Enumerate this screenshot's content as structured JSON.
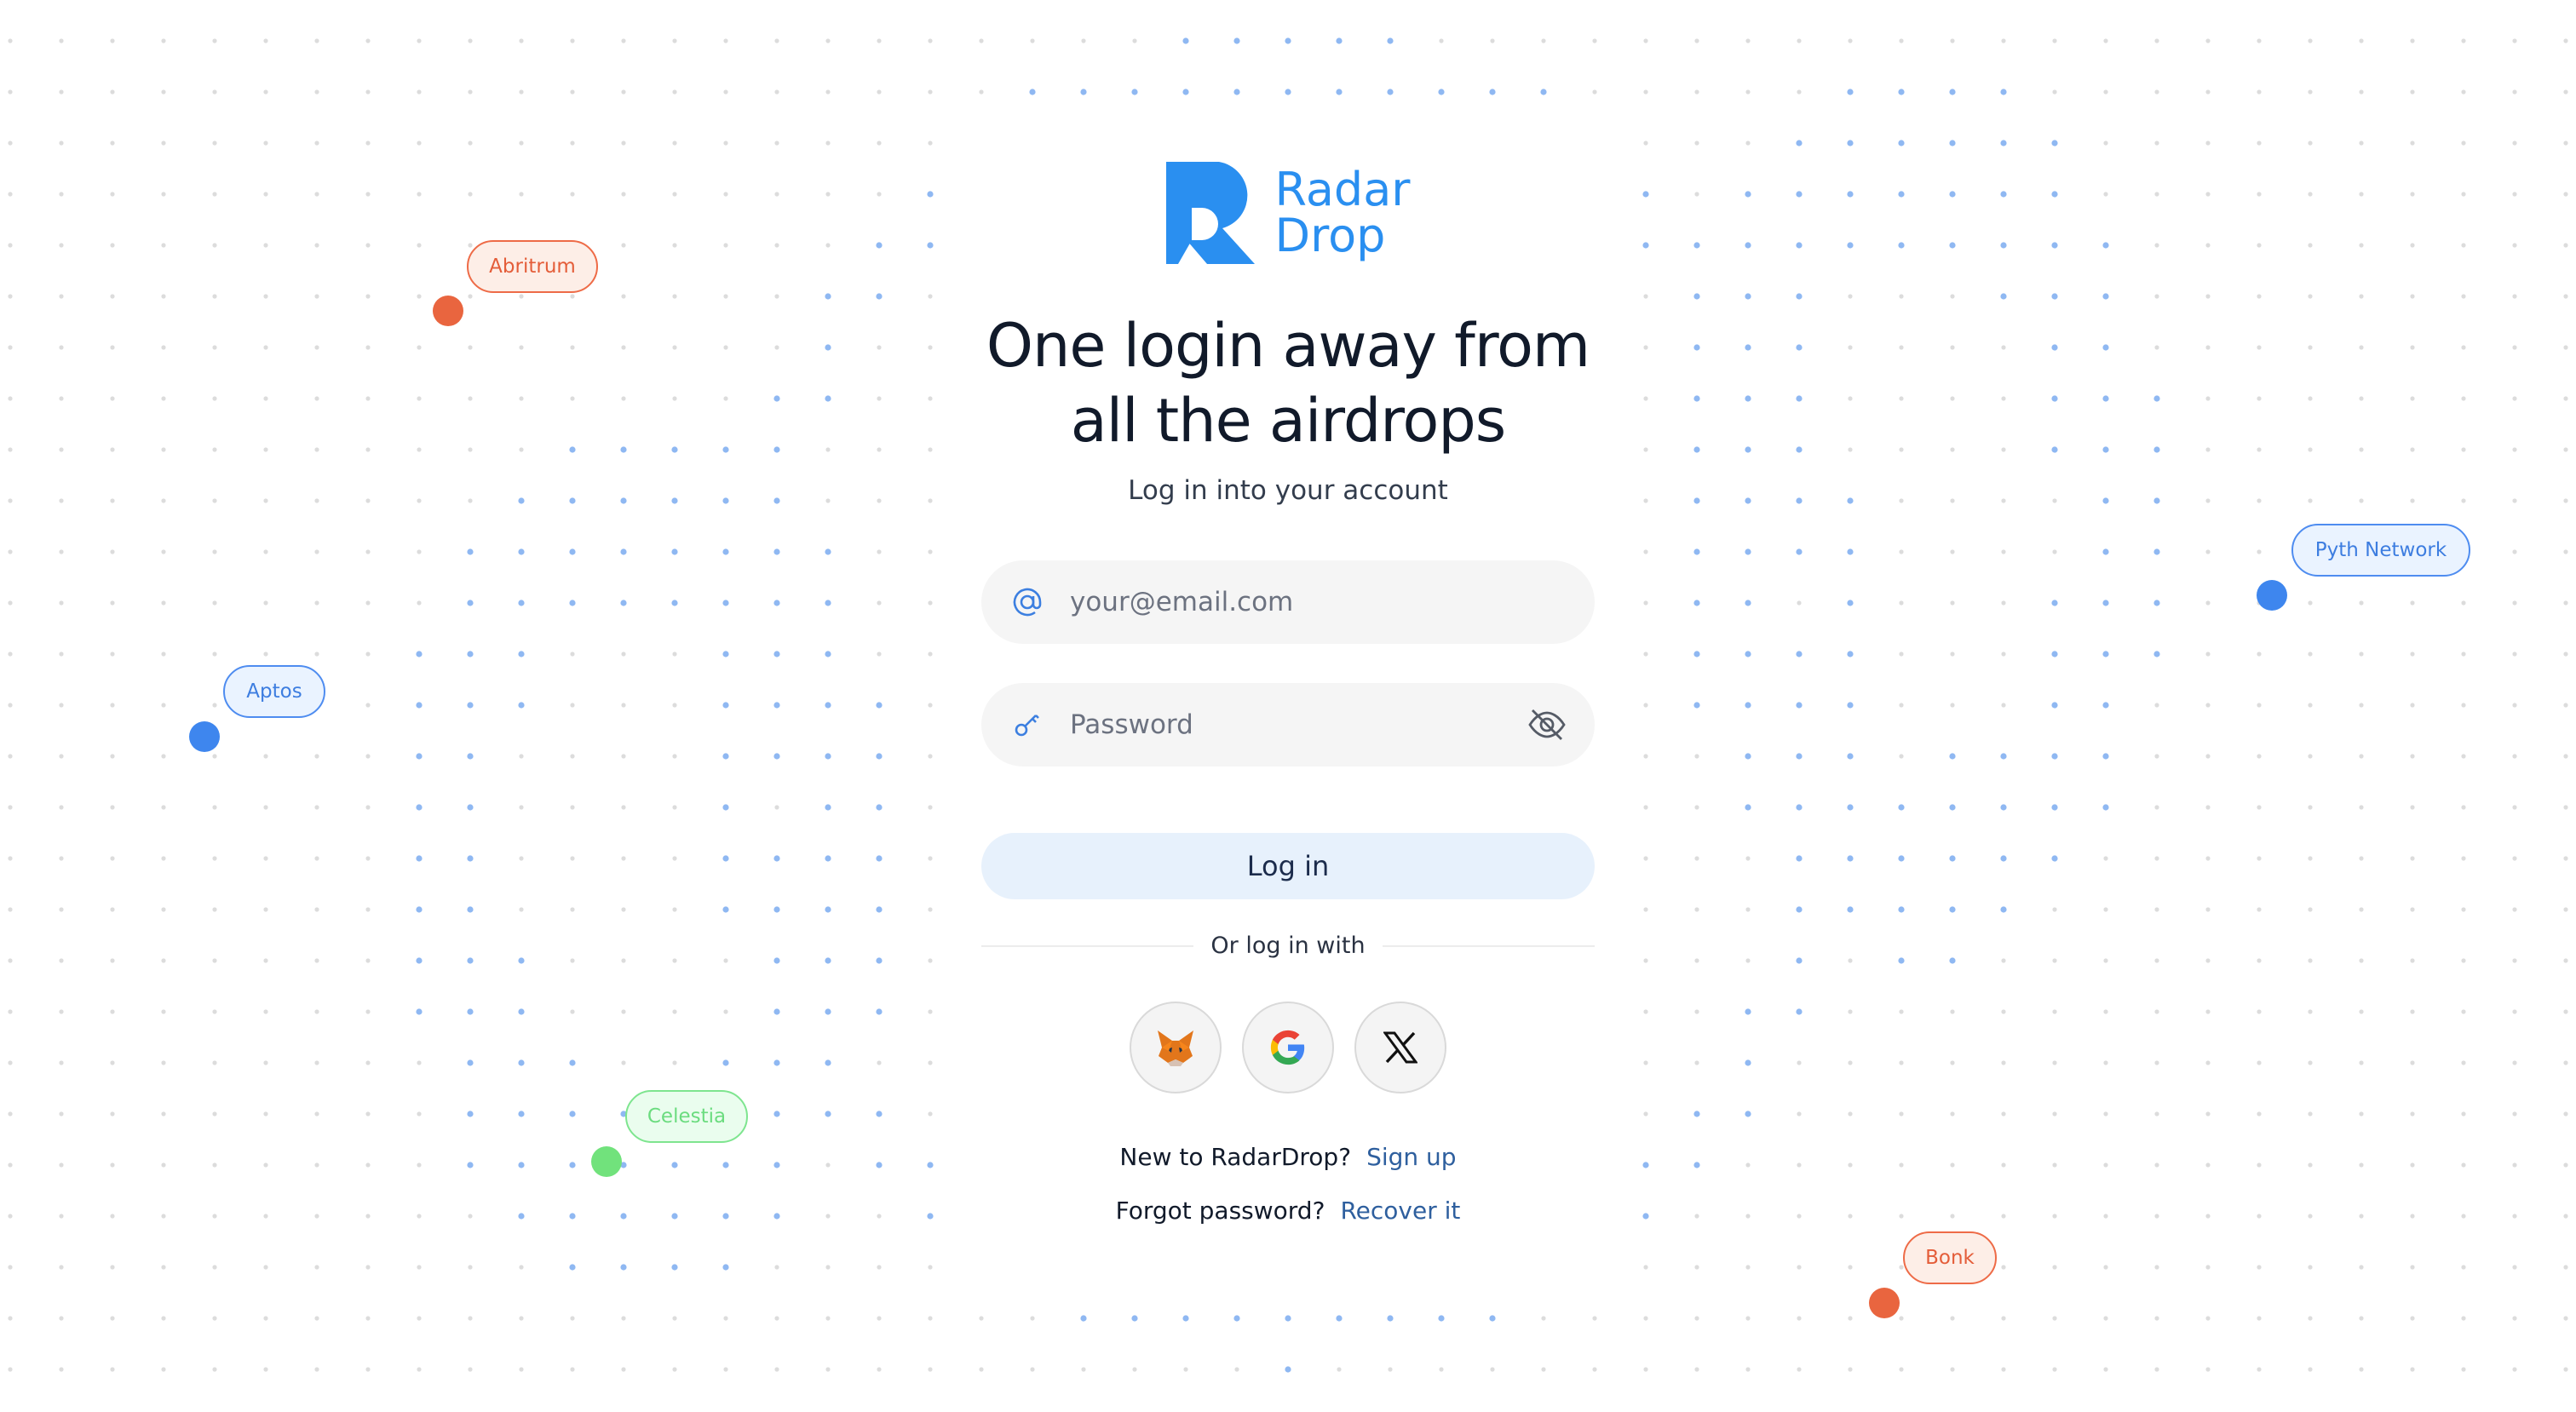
{
  "brand": {
    "name_line1": "Radar",
    "name_line2": "Drop",
    "color": "#2a8ff0"
  },
  "headline": {
    "line1": "One login away from",
    "line2": "all the airdrops"
  },
  "subtitle": "Log in into your account",
  "email": {
    "placeholder": "your@email.com",
    "value": "",
    "icon": "at-icon"
  },
  "password": {
    "placeholder": "Password",
    "value": "",
    "icon": "key-icon",
    "toggle_icon": "eye-off-icon"
  },
  "login_button": "Log in",
  "divider_text": "Or log in with",
  "social": [
    {
      "name": "MetaMask",
      "icon": "metamask-fox-icon"
    },
    {
      "name": "Google",
      "icon": "google-icon"
    },
    {
      "name": "X",
      "icon": "x-icon"
    }
  ],
  "signup": {
    "question": "New to RadarDrop?",
    "link": "Sign up"
  },
  "recover": {
    "question": "Forgot password?",
    "link": "Recover it"
  },
  "floating_tags": [
    {
      "label": "Abritrum",
      "color": "orange"
    },
    {
      "label": "Aptos",
      "color": "blue"
    },
    {
      "label": "Celestia",
      "color": "green"
    },
    {
      "label": "Pyth Network",
      "color": "blue"
    },
    {
      "label": "Bonk",
      "color": "orange"
    }
  ],
  "colors": {
    "accent": "#2a8ff0",
    "orange": "#e9653f",
    "blue": "#3e86ee",
    "green": "#71e27c"
  }
}
